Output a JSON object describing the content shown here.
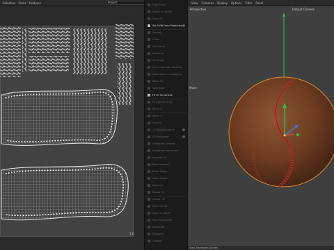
{
  "menu": {
    "items": [
      "Selection",
      "Faces",
      "Features"
    ],
    "dropdown_value": "Project"
  },
  "uv": {
    "page_number": "1.0"
  },
  "ops": {
    "items": [
      {
        "label": "Grab Mode"
      },
      {
        "label": "Select All Active"
      },
      {
        "label": "Clear All"
      },
      {
        "label": "Set UVW from Projection",
        "active": true,
        "gear": true
      },
      {
        "label": "Frontal"
      },
      {
        "label": "Cubic"
      },
      {
        "label": "Cylindrical"
      },
      {
        "label": "Spherical"
      },
      {
        "label": "UV Shells"
      },
      {
        "label": "Pack Automatic Mapping"
      },
      {
        "label": "Auto Island Unwrapping"
      },
      {
        "label": "Relax UV"
      },
      {
        "label": "Normalize"
      },
      {
        "label": "Fit UV to Canvas",
        "active": true
      },
      {
        "label": "Fit Canvas to UV"
      },
      {
        "label": "Mirror U"
      },
      {
        "label": "Mirror V"
      },
      {
        "label": "Flip UV"
      },
      {
        "label": "UV Rectangularize",
        "gear": true
      },
      {
        "label": "UV Straighten",
        "gear": true
      },
      {
        "label": "Straighten Vertical"
      },
      {
        "label": "Straighten Horizontal"
      },
      {
        "label": "Equalize UV"
      },
      {
        "label": "Weld Vertices"
      },
      {
        "label": "Break Edges"
      },
      {
        "label": "Stitch Edges"
      },
      {
        "label": "Align UV"
      },
      {
        "label": "Rotate 90"
      },
      {
        "label": "Rotate -90"
      },
      {
        "label": "Scale UV Up"
      },
      {
        "label": "Scale UV Down"
      },
      {
        "label": "Pack Rectangles"
      },
      {
        "label": "Distribute"
      },
      {
        "label": "Snapping"
      },
      {
        "label": "Options"
      }
    ]
  },
  "viewport": {
    "menu": [
      "View",
      "Cameras",
      "Display",
      "Options",
      "Filter",
      "Panel"
    ],
    "mode": "Perspective",
    "camera": "Default Camera",
    "side_label": "Move",
    "status": "View Transform: Screen"
  },
  "colors": {
    "ball": "#6b3a20",
    "stitch": "#c0312b",
    "outline": "#e28a2a",
    "axis_y": "#27c24c",
    "axis_x": "#d44a4a",
    "axis_z": "#3a7be0"
  }
}
